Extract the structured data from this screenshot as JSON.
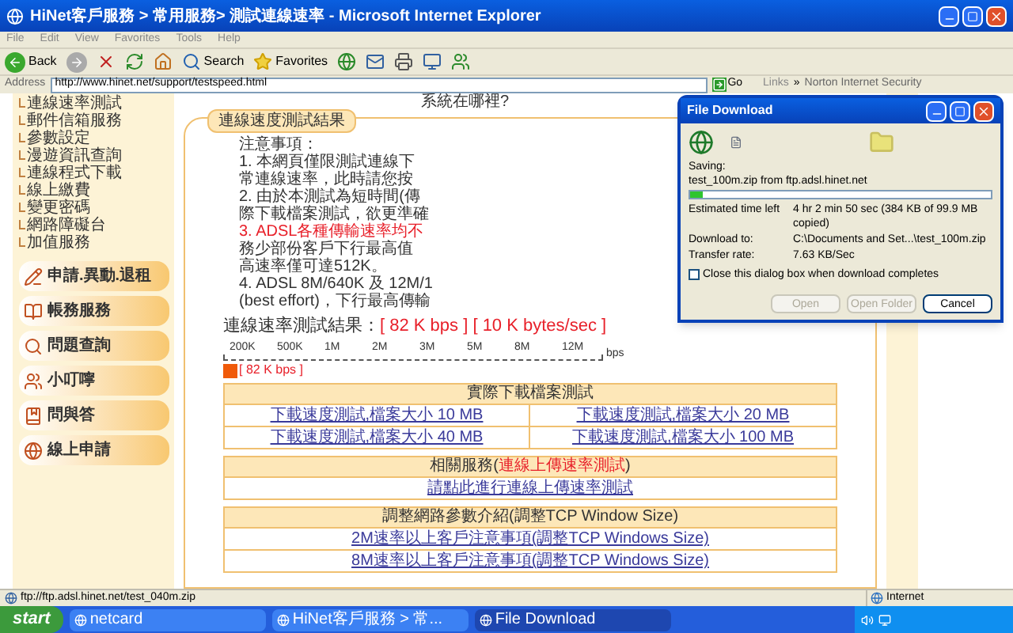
{
  "window": {
    "title": "HiNet客戶服務 > 常用服務> 測試連線速率 - Microsoft Internet Explorer"
  },
  "menu": [
    "File",
    "Edit",
    "View",
    "Favorites",
    "Tools",
    "Help"
  ],
  "toolbar": {
    "back": "Back",
    "search": "Search",
    "favorites": "Favorites"
  },
  "address": {
    "label": "Address",
    "url": "http://www.hinet.net/support/testspeed.html",
    "go": "Go",
    "links": "Links",
    "chevron": "»",
    "norton": "Norton Internet Security"
  },
  "page": {
    "top_strip": "系統在哪裡?",
    "sidebar_links": [
      "連線速率測試",
      "郵件信箱服務",
      "參數設定",
      "漫遊資訊查詢",
      "連線程式下載",
      "線上繳費",
      "變更密碼",
      "網路障礙台",
      "加值服務"
    ],
    "sidebar_buttons": [
      "申請.異動.退租",
      "帳務服務",
      "問題查詢",
      "小叮嚀",
      "問與答",
      "線上申請"
    ],
    "result_tab": "連線速度測試結果",
    "notes": [
      {
        "text": "注意事項：",
        "kind": "normal"
      },
      {
        "text": "1. 本網頁僅限測試連線下",
        "kind": "normal"
      },
      {
        "text": "常連線速率，此時請您按",
        "kind": "normal"
      },
      {
        "text": "2. 由於本測試為短時間(傳",
        "kind": "normal"
      },
      {
        "text": "際下載檔案測試，欲更準確",
        "kind": "normal"
      },
      {
        "text": "3. ADSL各種傳輸速率均不",
        "kind": "alert"
      },
      {
        "text": "務少部份客戶下行最高值",
        "kind": "normal"
      },
      {
        "text": "高速率僅可達512K。",
        "kind": "normal"
      },
      {
        "text": "4. ADSL 8M/640K 及 12M/1",
        "kind": "normal"
      },
      {
        "text": "(best effort)，下行最高傳輸",
        "kind": "normal"
      }
    ],
    "result": {
      "label": "連線速率測試結果：",
      "value": "[ 82 K bps ] [ 10 K bytes/sec ]"
    },
    "scale": {
      "ticks": [
        "200K",
        "500K",
        "1M",
        "2M",
        "3M",
        "5M",
        "8M",
        "12M"
      ],
      "unit": "bps",
      "reading": "[ 82 K bps ]"
    },
    "tables": [
      {
        "kind": "two_column",
        "heading": [
          {
            "text": "實際下載檔案測試",
            "kind": "normal"
          }
        ],
        "links": [
          "下載速度測試,檔案大小 10 MB",
          "下載速度測試,檔案大小 20 MB",
          "下載速度測試,檔案大小 40 MB",
          "下載速度測試,檔案大小 100 MB"
        ]
      },
      {
        "kind": "single",
        "heading": [
          {
            "text": "相關服務(",
            "kind": "normal"
          },
          {
            "text": "連線上傳速率測試",
            "kind": "alert"
          },
          {
            "text": ")",
            "kind": "normal"
          }
        ],
        "links": [
          "請點此進行連線上傳速率測試"
        ]
      },
      {
        "kind": "single",
        "heading": [
          {
            "text": "調整網路參數介紹(調整TCP Window Size)",
            "kind": "normal"
          }
        ],
        "links": [
          "2M速率以上客戶注意事項(調整TCP Windows Size)",
          "8M速率以上客戶注意事項(調整TCP Windows Size)"
        ]
      }
    ]
  },
  "dialog": {
    "title": "File Download",
    "saving": "Saving:",
    "file": "test_100m.zip from ftp.adsl.hinet.net",
    "level": 0.04,
    "rows": [
      {
        "label": "Estimated time left",
        "value": "4 hr 2 min 50 sec (384 KB of 99.9 MB copied)"
      },
      {
        "label": "Download to:",
        "value": "C:\\Documents and Set...\\test_100m.zip"
      },
      {
        "label": "Transfer rate:",
        "value": "7.63 KB/Sec"
      }
    ],
    "close_option": {
      "label": "Close this dialog box when download completes",
      "checked": false
    },
    "buttons": [
      {
        "label": "Open",
        "disabled": true
      },
      {
        "label": "Open Folder",
        "disabled": true
      },
      {
        "label": "Cancel",
        "disabled": false
      }
    ]
  },
  "status_bar": {
    "text": "ftp://ftp.adsl.hinet.net/test_040m.zip",
    "zone": "Internet"
  },
  "taskbar": {
    "start": "start",
    "tasks": [
      {
        "label": "netcard",
        "selected": false
      },
      {
        "label": "HiNet客戶服務 > 常...",
        "selected": false
      },
      {
        "label": "File Download",
        "selected": true
      }
    ]
  }
}
